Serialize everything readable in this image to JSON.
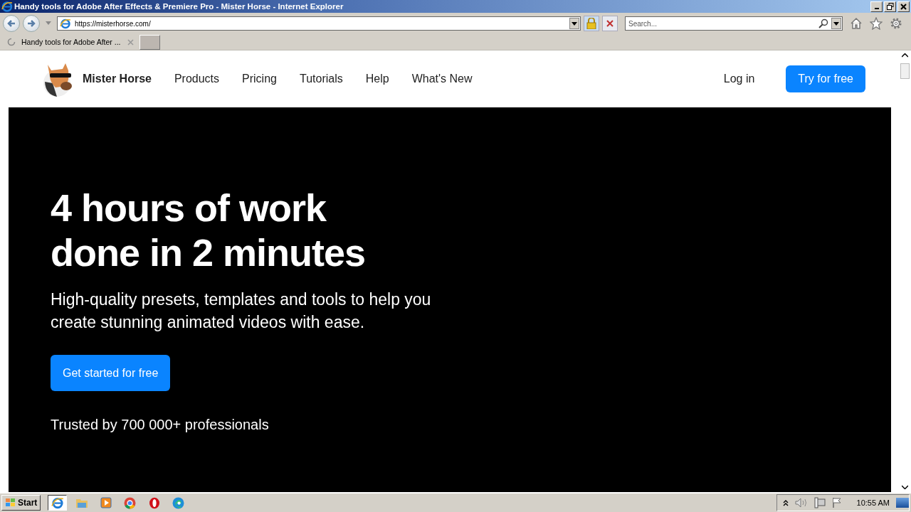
{
  "window": {
    "title": "Handy tools for Adobe After Effects & Premiere Pro - Mister Horse - Internet Explorer"
  },
  "address_bar": {
    "url": "https://misterhorse.com/"
  },
  "search": {
    "placeholder": "Search..."
  },
  "tabs": [
    {
      "label": "Handy tools for Adobe After ...",
      "selected": true,
      "loading": true
    }
  ],
  "site": {
    "brand": "Mister Horse",
    "nav": [
      {
        "label": "Products"
      },
      {
        "label": "Pricing"
      },
      {
        "label": "Tutorials"
      },
      {
        "label": "Help"
      },
      {
        "label": "What's New"
      }
    ],
    "login": "Log in",
    "cta": "Try for free",
    "headline": [
      "4 hours of work",
      "done in 2 minutes"
    ],
    "subtitle": "High-quality presets, templates and tools to help you create stunning animated videos with ease.",
    "hero_button": "Get started for free",
    "trusted": "Trusted by 700 000+ professionals"
  },
  "taskbar": {
    "start": "Start",
    "apps": [
      {
        "kind": "ie",
        "selected": true
      },
      {
        "kind": "folder",
        "selected": false
      },
      {
        "kind": "media",
        "selected": false
      },
      {
        "kind": "chrome",
        "selected": false
      },
      {
        "kind": "opera",
        "selected": false
      },
      {
        "kind": "edge",
        "selected": false
      }
    ],
    "clock": "10:55 AM"
  }
}
